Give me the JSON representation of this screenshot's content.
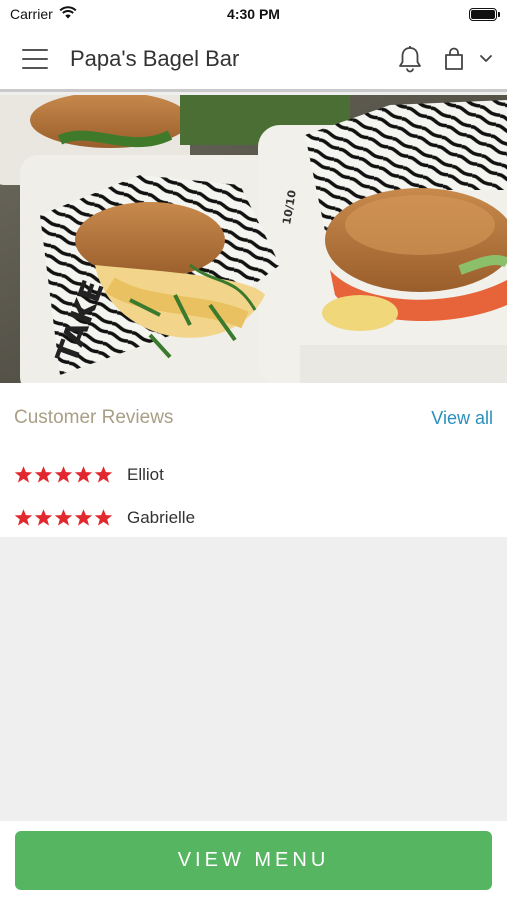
{
  "status_bar": {
    "carrier": "Carrier",
    "time": "4:30 PM"
  },
  "header": {
    "title": "Papa's Bagel Bar"
  },
  "hero": {
    "image_subject": "bagel sandwiches in takeout boxes",
    "wrapper_text_1": "10/10",
    "wrapper_text_2": "TAKE"
  },
  "reviews": {
    "title": "Customer Reviews",
    "view_all_label": "View all",
    "items": [
      {
        "name": "Elliot",
        "rating": 5
      },
      {
        "name": "Gabrielle",
        "rating": 5
      }
    ]
  },
  "footer": {
    "button_label": "VIEW MENU"
  },
  "colors": {
    "accent_green": "#55b560",
    "link_blue": "#2a8fbd",
    "star_red": "#e0282e",
    "section_title": "#a89f86"
  }
}
